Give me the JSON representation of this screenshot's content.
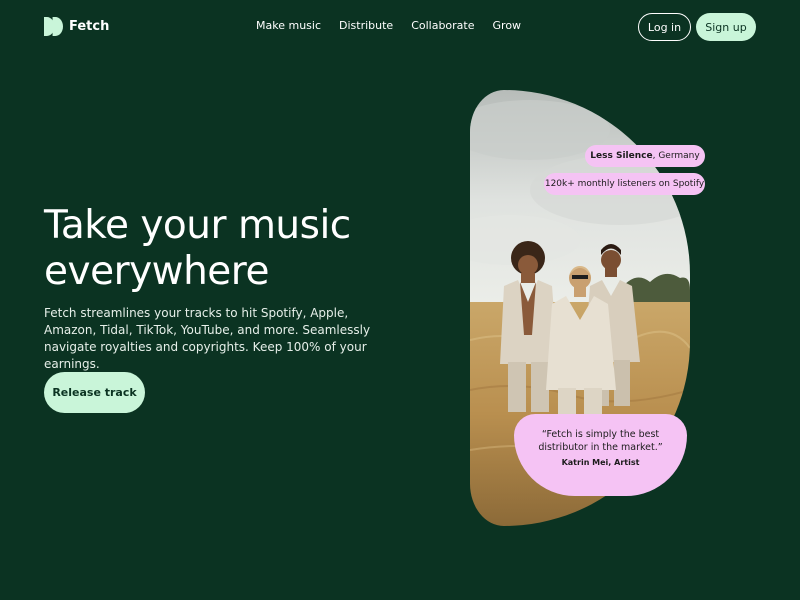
{
  "brand": {
    "name": "Fetch",
    "logo_icon": "double-d-logo-icon",
    "accent": "#c9f5d9",
    "background": "#0b3322",
    "highlight": "#f5c3f4"
  },
  "nav": {
    "links": [
      "Make music",
      "Distribute",
      "Collaborate",
      "Grow"
    ],
    "login_label": "Log in",
    "signup_label": "Sign up"
  },
  "hero": {
    "title_line1": "Take your music",
    "title_line2": "everywhere",
    "description": "Fetch streamlines your tracks to hit Spotify, Apple, Amazon, Tidal, TikTok, YouTube, and more. Seamlessly navigate royalties and copyrights. Keep 100% of your earnings.",
    "cta_label": "Release track"
  },
  "artist_card": {
    "artist_name": "Less Silence",
    "location": ", Germany",
    "listeners": "120k+ monthly listeners on Spotify"
  },
  "testimonial": {
    "quote": "“Fetch is simply the best distributor in the market.”",
    "author": "Katrin Mei, Artist"
  }
}
